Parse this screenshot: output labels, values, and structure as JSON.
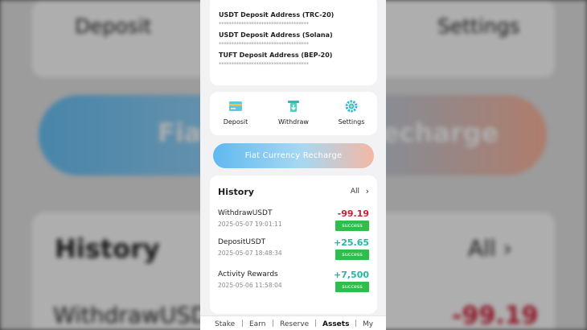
{
  "background": {
    "deposit_label": "Deposit",
    "settings_label": "Settings",
    "banner_label": "Fiat Currency Recharge",
    "history_label": "History",
    "all_label": "All",
    "withdraw_label": "WithdrawUSDT",
    "withdraw_amount": "-99.19"
  },
  "addresses": [
    {
      "label": "USDT Deposit Address (TRC-20)",
      "value": "************************************"
    },
    {
      "label": "USDT Deposit Address (Solana)",
      "value": "************************************"
    },
    {
      "label": "TUFT Deposit Address (BEP-20)",
      "value": "************************************"
    }
  ],
  "actions": [
    {
      "label": "Deposit",
      "icon": "card-icon"
    },
    {
      "label": "Withdraw",
      "icon": "withdraw-icon"
    },
    {
      "label": "Settings",
      "icon": "gear-icon"
    }
  ],
  "recharge_button": "Fiat Currency Recharge",
  "history": {
    "title": "History",
    "all_label": "All",
    "items": [
      {
        "name": "WithdrawUSDT",
        "time": "2025-05-07 19:01:11",
        "amount": "-99.19",
        "status": "success"
      },
      {
        "name": "DepositUSDT",
        "time": "2025-05-07 18:48:34",
        "amount": "+25.65",
        "status": "success"
      },
      {
        "name": "Activity Rewards",
        "time": "2025-05-06 11:58:04",
        "amount": "+7,500",
        "status": "success"
      }
    ]
  },
  "nav": {
    "items": [
      "Stake",
      "Earn",
      "Reserve",
      "Assets",
      "My"
    ],
    "separator": "|",
    "active": "Assets"
  },
  "colors": {
    "negative": "#cf1d3a",
    "positive": "#22b7a2",
    "success_badge": "#2fbe4a"
  }
}
